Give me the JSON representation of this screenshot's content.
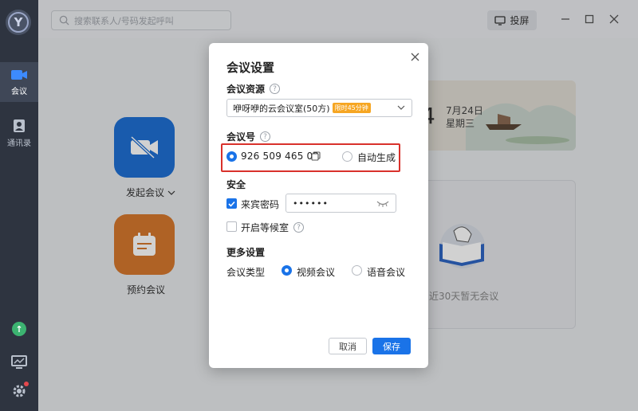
{
  "search": {
    "placeholder": "搜索联系人/号码发起呼叫"
  },
  "topbar": {
    "cast_label": "投屏"
  },
  "sidebar": {
    "logo": "Y",
    "items": [
      {
        "label": "会议",
        "icon": "video-camera-icon"
      },
      {
        "label": "通讯录",
        "icon": "contacts-icon"
      }
    ],
    "bottom_icons": [
      "upgrade-icon",
      "monitor-chart-icon",
      "settings-gear-icon"
    ]
  },
  "main": {
    "start_meeting_label": "发起会议",
    "schedule_meeting_label": "预约会议",
    "banner": {
      "day_digit": "4",
      "date": "7月24日",
      "weekday": "星期三"
    },
    "empty_text": "近30天暂无会议"
  },
  "dialog": {
    "title": "会议设置",
    "resource_heading": "会议资源",
    "resource_value": "咿呀咿的云会议室(50方)",
    "resource_tag": "限时45分钟",
    "meeting_id_heading": "会议号",
    "meeting_id_value": "926 509 465 02",
    "auto_generate_label": "自动生成",
    "security_heading": "安全",
    "guest_password_label": "来宾密码",
    "guest_password_value": "••••••",
    "waiting_room_label": "开启等候室",
    "more_heading": "更多设置",
    "meeting_type_label": "会议类型",
    "video_option": "视频会议",
    "audio_option": "语音会议",
    "cancel_label": "取消",
    "save_label": "保存"
  },
  "colors": {
    "accent": "#1a73e8",
    "highlight_box": "#d9312b",
    "sidebar": "#2e3440",
    "tag": "#f6a623"
  }
}
